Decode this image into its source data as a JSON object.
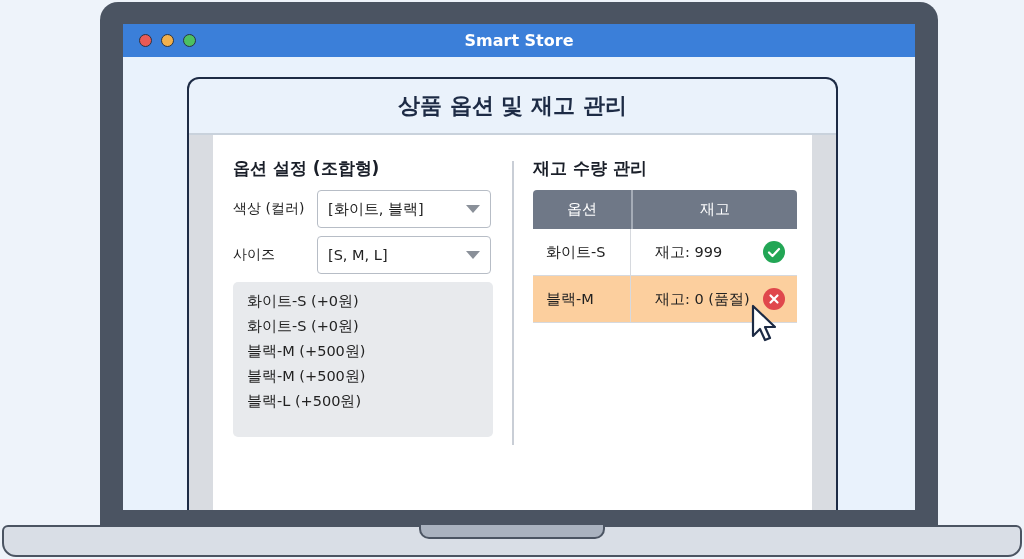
{
  "window": {
    "title": "Smart Store"
  },
  "page_title": "상품 옵션 및 재고 관리",
  "options": {
    "title": "옵션 설정 (조합형)",
    "fields": [
      {
        "label": "색상 (컬러)",
        "value": "[화이트, 블랙]"
      },
      {
        "label": "사이즈",
        "value": "[S, M, L]"
      }
    ],
    "combinations": [
      "화이트-S (+0원)",
      "화이트-S (+0원)",
      "블랙-M (+500원)",
      "블랙-M (+500원)",
      "블랙-L (+500원)"
    ]
  },
  "stock": {
    "title": "재고 수량 관리",
    "columns": [
      "옵션",
      "재고"
    ],
    "rows": [
      {
        "option": "화이트-S",
        "stock": "재고: 999",
        "kind": "ok",
        "selected": false
      },
      {
        "option": "블랙-M",
        "stock": "재고: 0 (품절)",
        "kind": "soldout",
        "selected": true
      }
    ]
  }
}
